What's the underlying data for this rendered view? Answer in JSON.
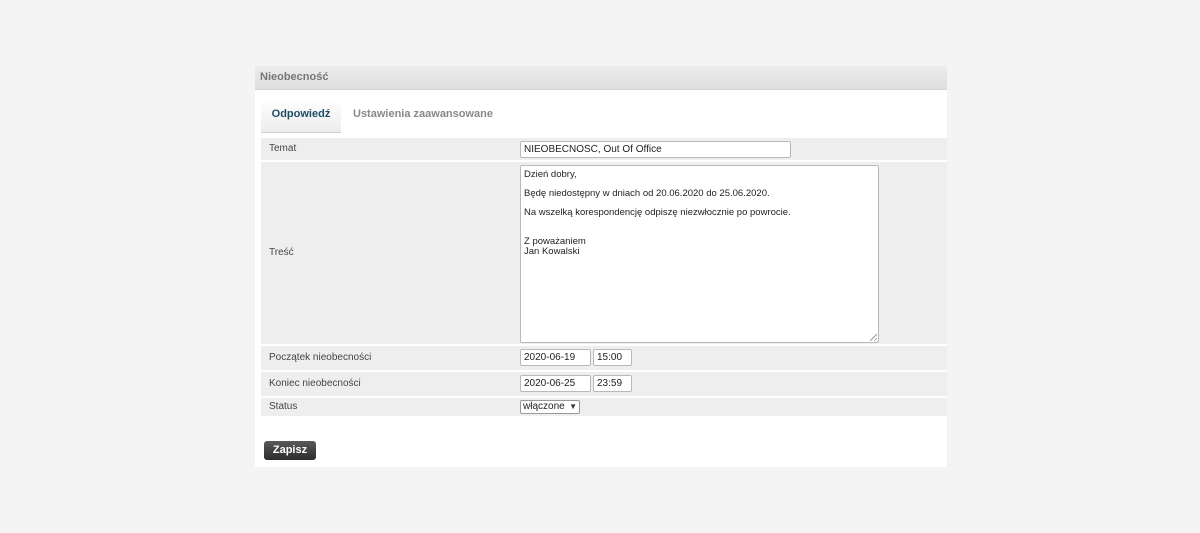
{
  "panel": {
    "title": "Nieobecność"
  },
  "tabs": [
    {
      "label": "Odpowiedź",
      "active": true
    },
    {
      "label": "Ustawienia zaawansowane",
      "active": false
    }
  ],
  "form": {
    "subject_label": "Temat",
    "subject_value": "NIEOBECNOŚĆ, Out Of Office",
    "body_label": "Treść",
    "body_lines": [
      "Dzień dobry,",
      "Będę niedostępny w dniach od 20.06.2020 do 25.06.2020.",
      "Na wszelką korespondencję odpiszę niezwłocznie po powrocie.",
      "Z poważaniem\nJan Kowalski"
    ],
    "start_label": "Początek nieobecności",
    "start_date": "2020-06-19",
    "start_time": "15:00",
    "end_label": "Koniec nieobecności",
    "end_date": "2020-06-25",
    "end_time": "23:59",
    "status_label": "Status",
    "status_value": "włączone"
  },
  "actions": {
    "save_label": "Zapisz"
  },
  "icons": {
    "select_chevron": "chevron-down-icon",
    "resize_grip": "resize-grip-icon"
  },
  "colors": {
    "accent_tab": "#1f4d63",
    "button_bg": "#3a3a3a",
    "row_bg": "#eeeeee",
    "page_bg": "#f4f4f4"
  }
}
